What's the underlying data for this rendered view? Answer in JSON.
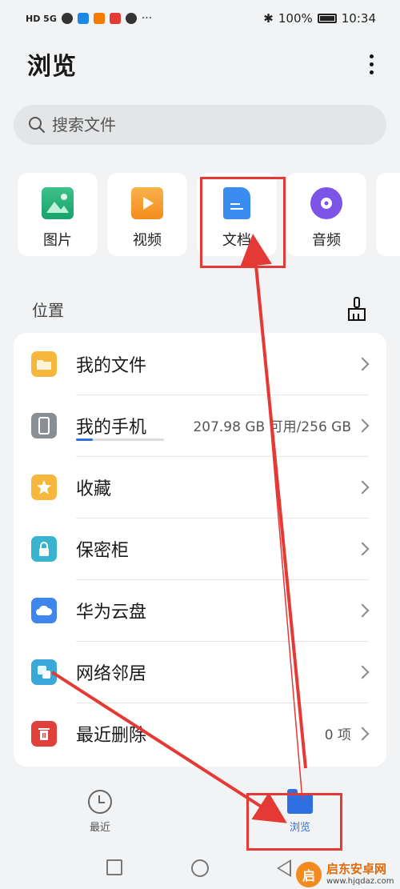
{
  "status_bar": {
    "left_text": "HD 5G",
    "bluetooth": "✱",
    "battery": "100%",
    "time": "10:34"
  },
  "header": {
    "title": "浏览"
  },
  "search": {
    "placeholder": "搜索文件"
  },
  "categories": [
    {
      "label": "图片",
      "icon": "image-icon"
    },
    {
      "label": "视频",
      "icon": "video-icon"
    },
    {
      "label": "文档",
      "icon": "document-icon"
    },
    {
      "label": "音频",
      "icon": "audio-icon"
    }
  ],
  "locations_section": {
    "title": "位置"
  },
  "locations": [
    {
      "label": "我的文件",
      "meta": ""
    },
    {
      "label": "我的手机",
      "meta": "207.98 GB 可用/256 GB",
      "storage_used_fraction": 0.19
    },
    {
      "label": "收藏",
      "meta": ""
    },
    {
      "label": "保密柜",
      "meta": ""
    },
    {
      "label": "华为云盘",
      "meta": ""
    },
    {
      "label": "网络邻居",
      "meta": ""
    },
    {
      "label": "最近删除",
      "meta": "0 项"
    }
  ],
  "bottom_nav": [
    {
      "label": "最近",
      "active": false
    },
    {
      "label": "浏览",
      "active": true
    }
  ],
  "colors": {
    "accent": "#2f6fe4",
    "annotation": "#e53935"
  },
  "watermark": {
    "logo": "启",
    "title": "启东安卓网",
    "url": "www.hjqdaz.com"
  }
}
